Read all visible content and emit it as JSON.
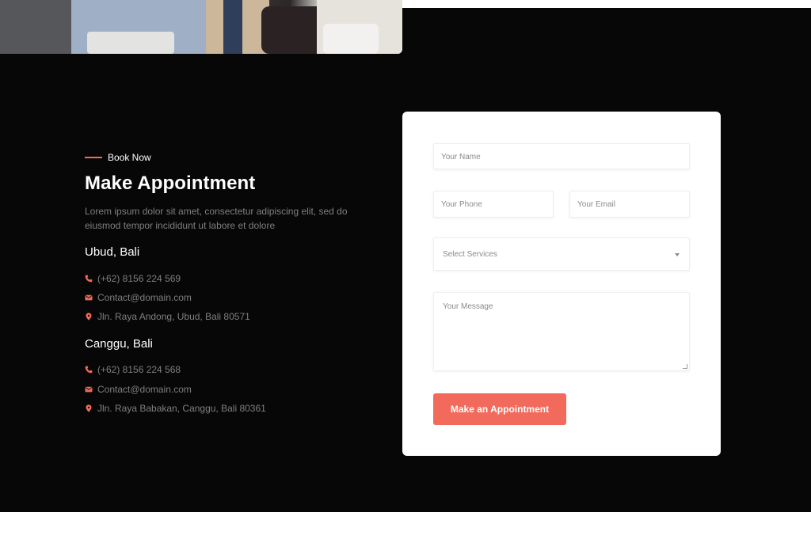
{
  "colors": {
    "accent": "#f26a5b",
    "dark_bg": "#070707",
    "card_bg": "#ffffff"
  },
  "hero_image": {
    "alt": ""
  },
  "section": {
    "eyebrow": "Book Now",
    "title": "Make Appointment",
    "description": "Lorem ipsum dolor sit amet, consectetur adipiscing elit, sed do eiusmod tempor incididunt ut labore et dolore"
  },
  "locations": [
    {
      "city": "Ubud, Bali",
      "phone": "(+62) 8156 224 569",
      "email": "Contact@domain.com",
      "address": "Jln. Raya Andong, Ubud, Bali 80571"
    },
    {
      "city": "Canggu, Bali",
      "phone": "(+62) 8156 224 568",
      "email": "Contact@domain.com",
      "address": "Jln. Raya Babakan, Canggu, Bali 80361"
    }
  ],
  "icons": {
    "phone": "phone-icon",
    "email": "envelope-icon",
    "address": "map-pin-icon"
  },
  "form": {
    "name_placeholder": "Your Name",
    "phone_placeholder": "Your Phone",
    "email_placeholder": "Your Email",
    "service_placeholder": "Select Services",
    "message_placeholder": "Your Message",
    "submit_label": "Make an Appointment"
  }
}
